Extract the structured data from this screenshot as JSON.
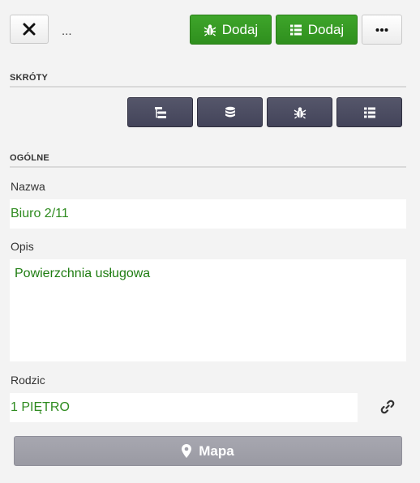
{
  "header": {
    "breadcrumb_text": "...",
    "add_bug_label": "Dodaj",
    "add_list_label": "Dodaj",
    "close_icon": "close-icon",
    "more_icon": "more-horizontal-icon"
  },
  "shortcuts": {
    "title": "SKRÓTY",
    "items": [
      {
        "icon": "tree-structure-icon"
      },
      {
        "icon": "database-icon"
      },
      {
        "icon": "bug-icon"
      },
      {
        "icon": "checklist-icon"
      }
    ]
  },
  "general": {
    "title": "OGÓLNE",
    "name_label": "Nazwa",
    "name_value": "Biuro 2/11",
    "desc_label": "Opis",
    "desc_value": "Powierzchnia usługowa",
    "parent_label": "Rodzic",
    "parent_value": "1 PIĘTRO"
  },
  "map_button": {
    "label": "Mapa",
    "icon": "map-marker-icon"
  },
  "colors": {
    "accent_green": "#2f8f1e",
    "field_text_green": "#2e8b1f",
    "shortcut_bg": "#4a4b60",
    "map_button_bg": "#a0a0a9"
  }
}
